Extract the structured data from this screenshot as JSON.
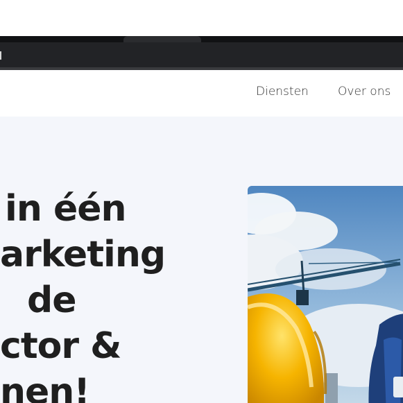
{
  "nav": {
    "items": [
      "Diensten",
      "Over ons"
    ]
  },
  "hero": {
    "heading_lines": [
      "in één",
      "arketing",
      "de",
      "ctor &",
      "nen!"
    ],
    "image_alt": "construction worker with yellow helmet and crane"
  },
  "colors": {
    "hero_background": "#f4f6fb",
    "heading": "#1f1f1f",
    "helmet": "#f6b400",
    "sky": "#5c8fc4"
  }
}
